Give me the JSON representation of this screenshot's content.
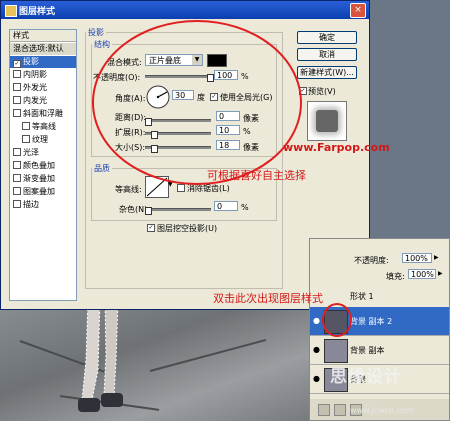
{
  "dialog": {
    "title": "图层样式",
    "close": "×",
    "styles_header": "样式",
    "styles": [
      {
        "label": "混合选项:默认",
        "checked": false,
        "kind": "header"
      },
      {
        "label": "投影",
        "checked": true,
        "selected": true
      },
      {
        "label": "内阴影",
        "checked": false
      },
      {
        "label": "外发光",
        "checked": false
      },
      {
        "label": "内发光",
        "checked": false
      },
      {
        "label": "斜面和浮雕",
        "checked": false
      },
      {
        "label": "等高线",
        "checked": false,
        "sub": true
      },
      {
        "label": "纹理",
        "checked": false,
        "sub": true
      },
      {
        "label": "光泽",
        "checked": false
      },
      {
        "label": "颜色叠加",
        "checked": false
      },
      {
        "label": "渐变叠加",
        "checked": false
      },
      {
        "label": "图案叠加",
        "checked": false
      },
      {
        "label": "描边",
        "checked": false
      }
    ],
    "section_title": "投影",
    "structure": {
      "legend": "结构",
      "blend_label": "混合模式:",
      "blend_value": "正片叠底",
      "blend_color": "#000000",
      "opacity_label": "不透明度(O):",
      "opacity_value": "100",
      "opacity_unit": "%",
      "angle_label": "角度(A):",
      "angle_value": "30",
      "angle_unit": "度",
      "global_light_label": "使用全局光(G)",
      "global_light_checked": true,
      "distance_label": "距离(D):",
      "distance_value": "0",
      "distance_unit": "像素",
      "spread_label": "扩展(R):",
      "spread_value": "10",
      "spread_unit": "%",
      "size_label": "大小(S):",
      "size_value": "18",
      "size_unit": "像素"
    },
    "quality": {
      "legend": "品质",
      "contour_label": "等高线:",
      "antialias_label": "消除锯齿(L)",
      "antialias_checked": false,
      "noise_label": "杂色(N):",
      "noise_value": "0",
      "noise_unit": "%"
    },
    "knockout_label": "图层挖空投影(U)",
    "knockout_checked": true,
    "buttons": {
      "ok": "确定",
      "cancel": "取消",
      "new_style": "新建样式(W)...",
      "preview": "预览(V)"
    },
    "preview_checked": true
  },
  "annotations": {
    "url": "www.Farpop.com",
    "choose": "可根据喜好自主选择",
    "double_click": "双击此次出现图层样式"
  },
  "layers": {
    "opacity_label": "不透明度:",
    "opacity_value": "100%",
    "fill_label": "填充:",
    "fill_value": "100%",
    "items": [
      {
        "name": "形状 1",
        "selected": false
      },
      {
        "name": "背景 副本 2",
        "selected": true
      },
      {
        "name": "背景 副本",
        "selected": false
      },
      {
        "name": "背景",
        "selected": false
      }
    ]
  },
  "watermark": {
    "text": "思缘设计",
    "url": "www.jcwcn.com"
  }
}
